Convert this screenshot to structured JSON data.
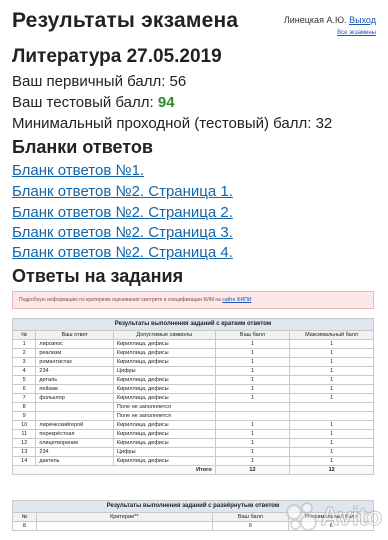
{
  "header": {
    "title": "Результаты экзамена",
    "user_name": "Линецкая А.Ю.",
    "logout_label": "Выход",
    "all_exams_label": "Все экзамены"
  },
  "exam": {
    "title": "Литература 27.05.2019",
    "primary_score_label": "Ваш первичный балл: 56",
    "test_score_label": "Ваш тестовый балл:",
    "test_score_value": "94",
    "min_score_label": "Минимальный проходной (тестовый) балл: 32"
  },
  "blanks": {
    "heading": "Бланки ответов",
    "links": [
      "Бланк ответов №1.",
      "Бланк ответов №2. Страница 1.",
      "Бланк ответов №2. Страница 2.",
      "Бланк ответов №2. Страница 3.",
      "Бланк ответов №2. Страница 4."
    ]
  },
  "answers": {
    "heading": "Ответы на задания",
    "notice_text": "Подробную информацию по критериям оценивания смотрите в спецификации КИМ на",
    "notice_link": "сайте ФИПИ"
  },
  "short_table": {
    "caption": "Результаты выполнения заданий с кратким ответом",
    "headers": [
      "№",
      "Ваш ответ",
      "Допустимые символы",
      "Ваш балл",
      "Максимальный балл"
    ],
    "rows": [
      [
        "1",
        "лирозпос",
        "Кириллица, дефисы",
        "1",
        "1"
      ],
      [
        "2",
        "реализм",
        "Кириллица, дефисы",
        "1",
        "1"
      ],
      [
        "3",
        "романтистах",
        "Кириллица, дефисы",
        "1",
        "1"
      ],
      [
        "4",
        "234",
        "Цифры",
        "1",
        "1"
      ],
      [
        "5",
        "деталь",
        "Кириллица, дефисы",
        "1",
        "1"
      ],
      [
        "6",
        "пейзаж",
        "Кириллица, дефисы",
        "1",
        "1"
      ],
      [
        "7",
        "фольклор",
        "Кириллица, дефисы",
        "1",
        "1"
      ],
      [
        "8",
        "",
        "Поле не заполняется",
        "",
        ""
      ],
      [
        "9",
        "",
        "Поле не заполняется",
        "",
        ""
      ],
      [
        "10",
        "лирическийгерой",
        "Кириллица, дефисы",
        "1",
        "1"
      ],
      [
        "11",
        "перекрёстная",
        "Кириллица, дефисы",
        "1",
        "1"
      ],
      [
        "12",
        "олицетворение",
        "Кириллица, дефисы",
        "1",
        "1"
      ],
      [
        "13",
        "234",
        "Цифры",
        "1",
        "1"
      ],
      [
        "14",
        "дактель",
        "Кириллица, дефисы",
        "1",
        "1"
      ]
    ],
    "total_label": "Итого",
    "total_score": "12",
    "total_max": "12"
  },
  "long_table": {
    "caption": "Результаты выполнения заданий с развёрнутым ответом",
    "headers": [
      "№",
      "Критерии**",
      "Ваш балл",
      "Максимальный балл"
    ],
    "rows": [
      [
        "8",
        "",
        "6",
        "6"
      ]
    ]
  },
  "watermark": {
    "text": "Avito"
  }
}
